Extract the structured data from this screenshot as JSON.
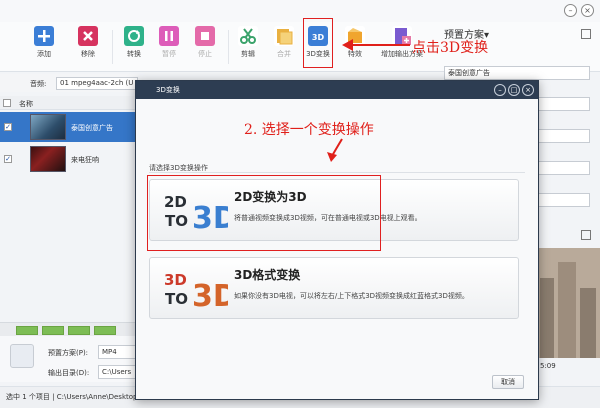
{
  "toolbar": {
    "buttons": [
      {
        "label": "添加",
        "icon": "add-icon",
        "color": "#3b7ed6"
      },
      {
        "label": "移除",
        "icon": "remove-icon",
        "color": "#d6335f"
      },
      {
        "label": "转换",
        "icon": "convert-icon",
        "color": "#2fb28a"
      },
      {
        "label": "暂停",
        "icon": "pause-icon",
        "color": "#dd5db9"
      },
      {
        "label": "停止",
        "icon": "stop-icon",
        "color": "#e46aa9"
      },
      {
        "label": "剪辑",
        "icon": "scissors-icon",
        "color": "#3aa36b"
      },
      {
        "label": "合并",
        "icon": "merge-icon",
        "color": "#e9b040"
      },
      {
        "label": "3D变换",
        "icon": "3d-icon",
        "color": "#3b7ed6"
      },
      {
        "label": "特效",
        "icon": "effects-icon",
        "color": "#f0a52e"
      },
      {
        "label": "增加输出方案",
        "icon": "add-output-icon",
        "color": "#7a5bd0"
      }
    ]
  },
  "annotations": {
    "top": "点击3D变换",
    "step2": "2. 选择一个变换操作"
  },
  "right_panel": {
    "preset_title": "预置方案▾",
    "preset_name": "泰国创意广告"
  },
  "audio": {
    "label": "音频:",
    "value": "01 mpeg4aac-2ch (U"
  },
  "file_list": {
    "name_header": "名称",
    "files": [
      {
        "name": "泰国创意广告",
        "checked": true,
        "selected": true
      },
      {
        "name": "来电狂响",
        "checked": true,
        "selected": false
      }
    ]
  },
  "bottom": {
    "preset_label": "预置方案(P):",
    "preset_value": "MP4",
    "output_label": "输出目录(D):",
    "output_value": "C:\\Users"
  },
  "status": {
    "text": "选中 1 个项目 | C:\\Users\\Anne\\Desktop"
  },
  "preview": {
    "time": "5:09"
  },
  "dialog": {
    "title": "3D变换",
    "section_label": "请选择3D变换操作",
    "options": [
      {
        "title": "2D变换为3D",
        "description": "将普通视频变换成3D视频，可在普通电视或3D电视上观看。",
        "logo_top": "2D",
        "logo_bottom": "TO",
        "logo_big": "3D"
      },
      {
        "title": "3D格式变换",
        "description": "如果你没有3D电视，可以将左右/上下格式3D视频变换成红蓝格式3D视频。",
        "logo_top": "3D",
        "logo_bottom": "TO",
        "logo_big": "3D"
      }
    ],
    "cancel": "取消"
  }
}
